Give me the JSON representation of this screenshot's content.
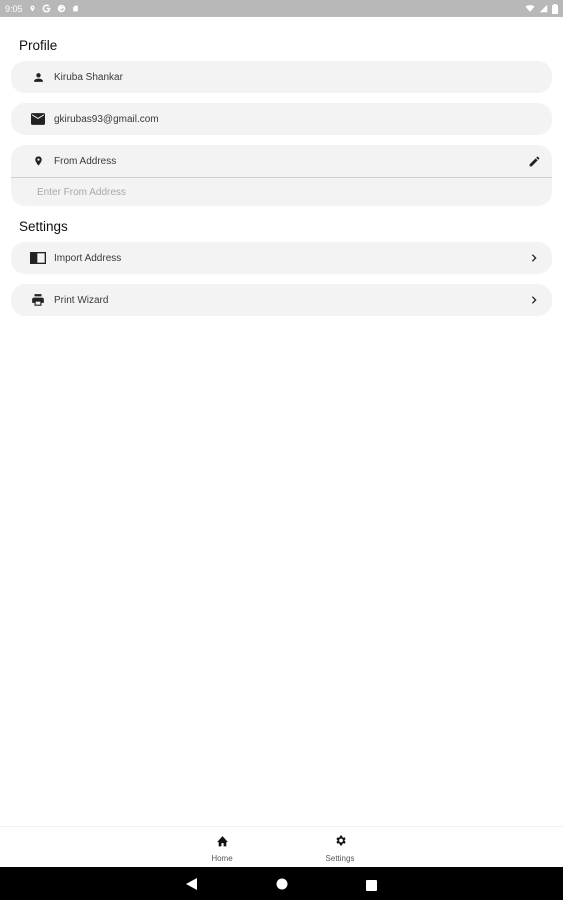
{
  "status_bar": {
    "time": "9:05",
    "left_icons": [
      "location-icon",
      "google-icon",
      "google-icon-2",
      "sd-card-icon"
    ],
    "right_icons": [
      "wifi-icon",
      "signal-icon",
      "battery-icon"
    ]
  },
  "profile": {
    "title": "Profile",
    "name": "Kiruba Shankar",
    "email": "gkirubas93@gmail.com",
    "from_address_label": "From Address",
    "from_address_placeholder": "Enter From Address",
    "from_address_value": ""
  },
  "settings": {
    "title": "Settings",
    "import_label": "Import Address",
    "print_label": "Print Wizard"
  },
  "bottom_nav": {
    "home_label": "Home",
    "settings_label": "Settings"
  },
  "colors": {
    "status_bar": "#b8b8b8",
    "card_bg": "#f3f3f3",
    "system_nav": "#000000"
  }
}
